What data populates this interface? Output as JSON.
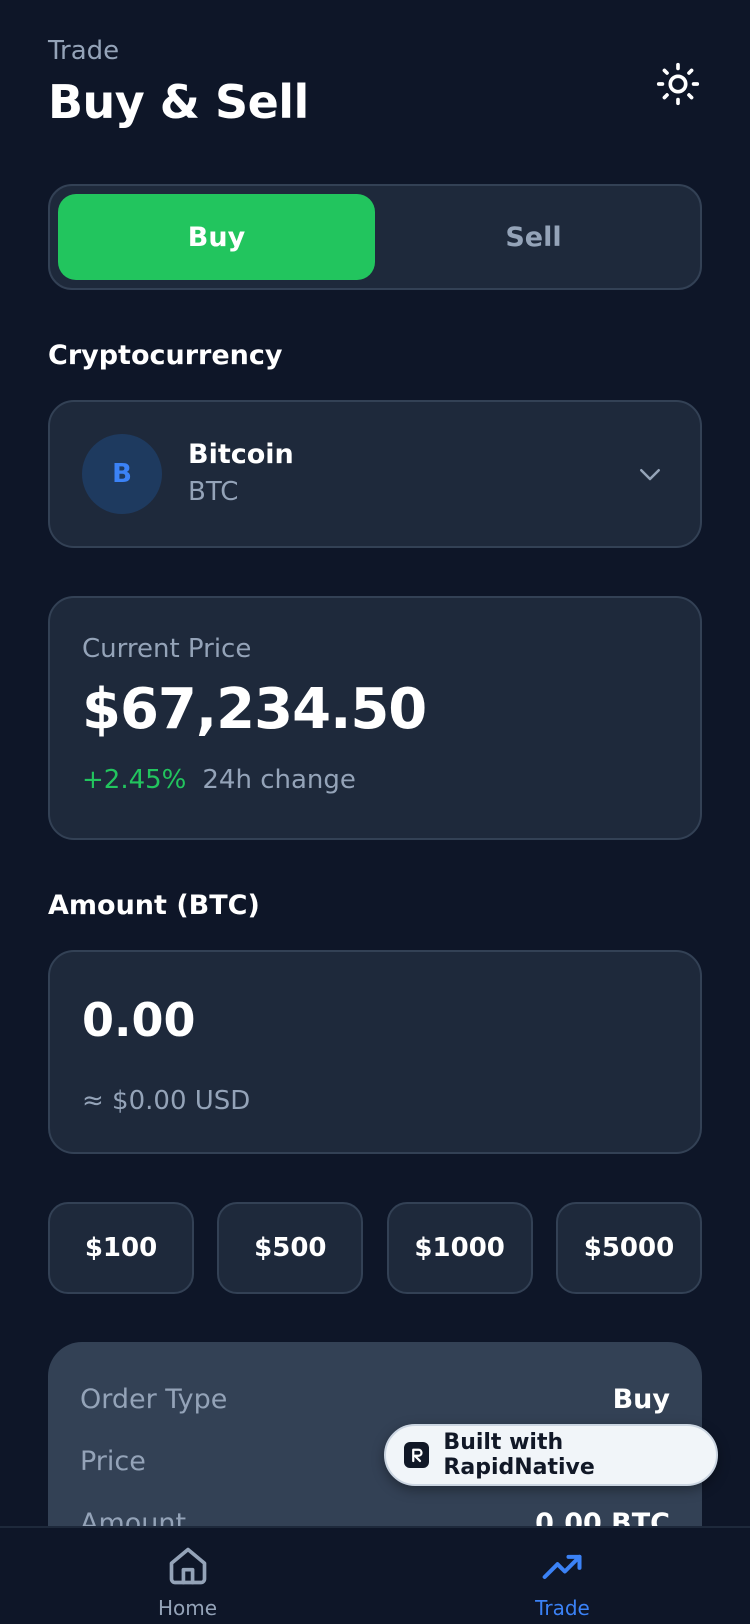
{
  "header": {
    "eyebrow": "Trade",
    "title": "Buy & Sell"
  },
  "mode_toggle": {
    "buy_label": "Buy",
    "sell_label": "Sell",
    "selected": "Buy"
  },
  "crypto": {
    "section_label": "Cryptocurrency",
    "avatar_letter": "B",
    "name": "Bitcoin",
    "symbol": "BTC"
  },
  "price": {
    "label": "Current Price",
    "value": "$67,234.50",
    "change_pct": "+2.45%",
    "change_label": "24h change"
  },
  "amount": {
    "section_label": "Amount (BTC)",
    "value": "0.00",
    "usd_equiv": "≈ $0.00 USD"
  },
  "quick_amounts": [
    "$100",
    "$500",
    "$1000",
    "$5000"
  ],
  "summary": {
    "rows": [
      {
        "key": "Order Type",
        "value": "Buy"
      },
      {
        "key": "Price",
        "value": ""
      },
      {
        "key": "Amount",
        "value": "0.00 BTC"
      }
    ]
  },
  "badge": {
    "label": "Built with RapidNative"
  },
  "tabbar": {
    "home_label": "Home",
    "trade_label": "Trade"
  },
  "colors": {
    "background": "#0e1628",
    "card": "#1e293b",
    "accent_green": "#22c55e",
    "accent_blue": "#3b82f6",
    "muted": "#94a3b8"
  },
  "icons": {
    "theme": "sun-icon",
    "dropdown": "chevron-down-icon",
    "home": "home-icon",
    "trade": "trending-up-icon",
    "badge_logo": "rapidnative-logo-icon"
  }
}
